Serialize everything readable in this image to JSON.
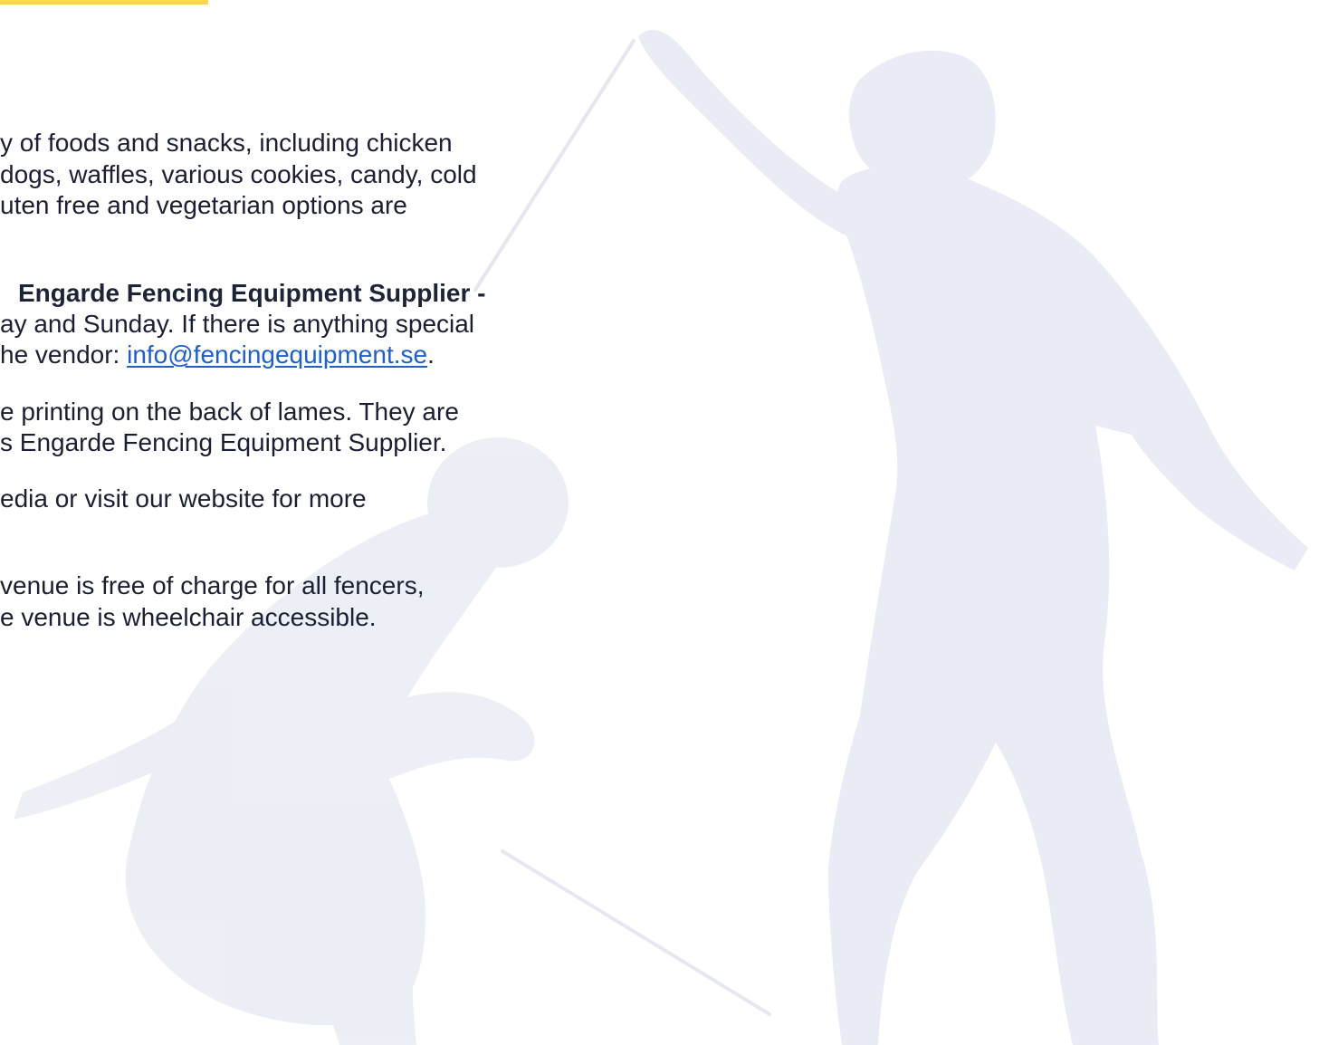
{
  "colors": {
    "accent": "#FFD54F",
    "text": "#1a1f33",
    "link": "#1f5fc9",
    "silhouette": "#e9ebf5"
  },
  "paragraphs": {
    "food": [
      "y of foods and snacks, including chicken",
      " dogs, waffles, various cookies, candy, cold",
      "uten free and vegetarian options are"
    ],
    "vendor": {
      "title": "Engarde Fencing Equipment Supplier -",
      "line_1": "ay and Sunday. If there is anything special",
      "line_2_prefix": "he vendor: ",
      "email": "info@fencingequipment.se",
      "line_2_suffix": "."
    },
    "printing": [
      "e printing on the back of lames. They are",
      "s Engarde Fencing Equipment Supplier."
    ],
    "social": [
      "edia or visit our website for more"
    ],
    "venue": [
      " venue is free of charge for all fencers,",
      "e venue is wheelchair accessible."
    ]
  }
}
